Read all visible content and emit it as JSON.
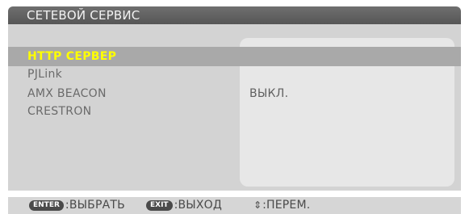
{
  "window": {
    "title": "СЕТЕВОЙ СЕРВИС"
  },
  "menu": {
    "items": [
      {
        "label": "HTTP СЕРВЕР",
        "selected": true
      },
      {
        "label": "PJLink",
        "selected": false
      },
      {
        "label": "AMX BEACON",
        "selected": false
      },
      {
        "label": "CRESTRON",
        "selected": false
      }
    ],
    "amx_beacon_value": "ВЫКЛ."
  },
  "status_bar": {
    "enter_key": "ENTER",
    "enter_action": ":ВЫБРАТЬ",
    "exit_key": "EXIT",
    "exit_action": ":ВЫХОД",
    "move_icon": "up-down-arrow-icon",
    "move_action": ":ПЕРЕМ."
  },
  "colors": {
    "title_bar": "#5e5e5e",
    "panel": "#d3d3d3",
    "value_panel": "#e7e7e7",
    "selection_bar": "#a9a9a9",
    "selected_text": "#ffff00",
    "item_text": "#6a6a6a"
  }
}
